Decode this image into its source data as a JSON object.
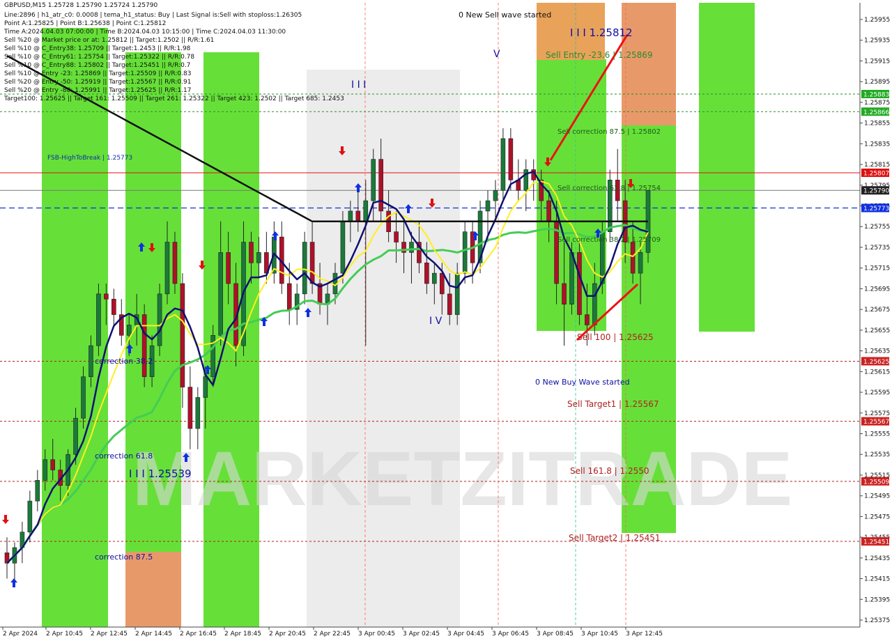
{
  "chart_data": {
    "type": "candlestick",
    "symbol_header": "GBPUSD,M15  1.25728 1.25790 1.25724 1.25790",
    "info_lines": [
      "Line:2896 | h1_atr_c0: 0.0008 | tema_h1_status: Buy | Last Signal is:Sell with stoploss:1.26305",
      "Point A:1.25825 | Point B:1.25638 | Point C:1.25812",
      "Time A:2024.04.03 07:00:00 | Time B:2024.04.03 10:15:00 | Time C:2024.04.03 11:30:00",
      "Sell %20 @ Market price or at: 1.25812 || Target:1.2502 || R/R:1.61",
      "Sell %10 @ C_Entry38: 1.25709 || Target:1.2453 || R/R:1.98",
      "Sell %10 @ C_Entry61: 1.25754 || Target:1.25322 || R/R:0.78",
      "Sell %10 @ C_Entry88: 1.25802 || Target:1.25451 || R/R:0.7",
      "Sell %10 @ Entry -23: 1.25869 || Target:1.25509 || R/R:0.83",
      "Sell %20 @ Entry -50: 1.25919 || Target:1.25567 || R/R:0.91",
      "Sell %20 @ Entry -88: 1.25991 || Target:1.25625 || R/R:1.17",
      "Target100: 1.25625 || Target 161: 1.25509 || Target 261: 1.25322 || Target 423: 1.2502 || Target 685: 1.2453"
    ],
    "y_axis": {
      "min": 1.25368,
      "max": 1.25912,
      "ticks": [
        "1.25955",
        "1.25935",
        "1.25915",
        "1.25895",
        "1.25875",
        "1.25855",
        "1.25835",
        "1.25815",
        "1.25795",
        "1.25775",
        "1.25755",
        "1.25735",
        "1.25715",
        "1.25695",
        "1.25675",
        "1.25655",
        "1.25635",
        "1.25615",
        "1.25595",
        "1.25575",
        "1.25555",
        "1.25535",
        "1.25515",
        "1.25495",
        "1.25475",
        "1.25455",
        "1.25435",
        "1.25415",
        "1.25395",
        "1.25375"
      ],
      "tick_values": [
        1.25955,
        1.25935,
        1.25915,
        1.25895,
        1.25875,
        1.25855,
        1.25835,
        1.25815,
        1.25795,
        1.25775,
        1.25755,
        1.25735,
        1.25715,
        1.25695,
        1.25675,
        1.25655,
        1.25635,
        1.25615,
        1.25595,
        1.25575,
        1.25555,
        1.25535,
        1.25515,
        1.25495,
        1.25475,
        1.25455,
        1.25435,
        1.25415,
        1.25395,
        1.25375
      ]
    },
    "x_labels": [
      "2 Apr 2024",
      "2 Apr 10:45",
      "2 Apr 12:45",
      "2 Apr 14:45",
      "2 Apr 16:45",
      "2 Apr 18:45",
      "2 Apr 20:45",
      "2 Apr 22:45",
      "3 Apr 00:45",
      "3 Apr 02:45",
      "3 Apr 04:45",
      "3 Apr 06:45",
      "3 Apr 08:45",
      "3 Apr 10:45",
      "3 Apr 12:45"
    ],
    "price_badges": [
      {
        "label": "1.25883",
        "value": 1.25883,
        "color": "#22aa22"
      },
      {
        "label": "1.25866",
        "value": 1.25866,
        "color": "#22aa22"
      },
      {
        "label": "1.25807",
        "value": 1.25807,
        "color": "#e01010"
      },
      {
        "label": "1.25790",
        "value": 1.2579,
        "color": "#222222"
      },
      {
        "label": "1.25773",
        "value": 1.25773,
        "color": "#1030e0"
      },
      {
        "label": "1.25625",
        "value": 1.25625,
        "color": "#cc2222"
      },
      {
        "label": "1.25567",
        "value": 1.25567,
        "color": "#cc2222"
      },
      {
        "label": "1.25509",
        "value": 1.25509,
        "color": "#cc2222"
      },
      {
        "label": "1.25451",
        "value": 1.25451,
        "color": "#cc2222"
      }
    ],
    "levels": [
      {
        "label": "Sell Entry -23.6 | 1.25869",
        "value": 1.25869,
        "color": "#2a8a2a"
      },
      {
        "label": "Sell correction 87.5 | 1.25802",
        "value": 1.25802,
        "color": "#2a8a2a"
      },
      {
        "label": "Sell correction 61.8 | 1.25754",
        "value": 1.25754,
        "color": "#2a8a2a"
      },
      {
        "label": "Sell correction 38.2 | 1.25709",
        "value": 1.25709,
        "color": "#2a8a2a"
      },
      {
        "label": "Sell 100 | 1.25625",
        "value": 1.25625,
        "color": "#b02020"
      },
      {
        "label": "Sell Target1 | 1.25567",
        "value": 1.25567,
        "color": "#b02020"
      },
      {
        "label": "Sell 161.8 | 1.2550",
        "value": 1.25509,
        "color": "#b02020"
      },
      {
        "label": "Sell Target2 | 1.25451",
        "value": 1.25451,
        "color": "#b02020"
      }
    ],
    "fsb_label": "FSB-HighToBreak | 1.25773",
    "annotations": [
      {
        "text": "0 New Sell wave started",
        "color": "#111111"
      },
      {
        "text": "0 New Buy Wave started",
        "color": "#1010a0"
      },
      {
        "text": "I I I 1.25812",
        "color": "#1010a0"
      },
      {
        "text": "I I I 1.25539",
        "color": "#1010a0"
      },
      {
        "text": "correction 38.2",
        "color": "#1010a0"
      },
      {
        "text": "correction 61.8",
        "color": "#1010a0"
      },
      {
        "text": "correction 87.5",
        "color": "#1010a0"
      },
      {
        "text": "I I I",
        "color": "#1010a0"
      },
      {
        "text": "I V",
        "color": "#1010a0"
      },
      {
        "text": "V",
        "color": "#1010a0"
      }
    ],
    "watermark": "MARKETZITRADE",
    "candles": [
      [
        1.2544,
        1.25455,
        1.25415,
        1.2543
      ],
      [
        1.2543,
        1.2545,
        1.2541,
        1.25445
      ],
      [
        1.25445,
        1.2547,
        1.2543,
        1.2546
      ],
      [
        1.2546,
        1.255,
        1.2545,
        1.2549
      ],
      [
        1.2549,
        1.2552,
        1.2548,
        1.2551
      ],
      [
        1.2551,
        1.2554,
        1.255,
        1.2553
      ],
      [
        1.2553,
        1.2555,
        1.2551,
        1.2552
      ],
      [
        1.2552,
        1.2553,
        1.2549,
        1.25505
      ],
      [
        1.25505,
        1.2554,
        1.25495,
        1.25535
      ],
      [
        1.25535,
        1.2558,
        1.25525,
        1.2557
      ],
      [
        1.2557,
        1.2562,
        1.2556,
        1.2561
      ],
      [
        1.2561,
        1.2565,
        1.256,
        1.2564
      ],
      [
        1.2564,
        1.257,
        1.2563,
        1.2569
      ],
      [
        1.2569,
        1.257,
        1.2566,
        1.25685
      ],
      [
        1.25685,
        1.25695,
        1.2566,
        1.2567
      ],
      [
        1.2567,
        1.25685,
        1.2564,
        1.2565
      ],
      [
        1.2565,
        1.2567,
        1.2563,
        1.2566
      ],
      [
        1.2566,
        1.2569,
        1.2564,
        1.2567
      ],
      [
        1.2567,
        1.2568,
        1.256,
        1.2561
      ],
      [
        1.2561,
        1.2565,
        1.256,
        1.2564
      ],
      [
        1.2564,
        1.257,
        1.2563,
        1.2569
      ],
      [
        1.2569,
        1.2576,
        1.2568,
        1.2574
      ],
      [
        1.2574,
        1.2575,
        1.2569,
        1.257
      ],
      [
        1.257,
        1.2571,
        1.2558,
        1.256
      ],
      [
        1.256,
        1.2562,
        1.2554,
        1.2556
      ],
      [
        1.2556,
        1.256,
        1.2554,
        1.2559
      ],
      [
        1.2559,
        1.2562,
        1.2556,
        1.2561
      ],
      [
        1.2561,
        1.2566,
        1.256,
        1.2565
      ],
      [
        1.2565,
        1.2576,
        1.2564,
        1.2573
      ],
      [
        1.2573,
        1.2575,
        1.2568,
        1.257
      ],
      [
        1.257,
        1.2572,
        1.2562,
        1.2564
      ],
      [
        1.2564,
        1.2576,
        1.2563,
        1.2574
      ],
      [
        1.2574,
        1.2575,
        1.257,
        1.2572
      ],
      [
        1.2572,
        1.25745,
        1.25705,
        1.2573
      ],
      [
        1.2573,
        1.2575,
        1.257,
        1.2571
      ],
      [
        1.2571,
        1.2576,
        1.257,
        1.25745
      ],
      [
        1.25745,
        1.2576,
        1.2569,
        1.257
      ],
      [
        1.257,
        1.2572,
        1.2566,
        1.25675
      ],
      [
        1.25675,
        1.257,
        1.2566,
        1.2569
      ],
      [
        1.2569,
        1.2575,
        1.2568,
        1.2574
      ],
      [
        1.2574,
        1.2576,
        1.2569,
        1.257
      ],
      [
        1.257,
        1.2572,
        1.2567,
        1.2568
      ],
      [
        1.2568,
        1.257,
        1.2566,
        1.2569
      ],
      [
        1.2569,
        1.2572,
        1.2568,
        1.2571
      ],
      [
        1.2571,
        1.2577,
        1.257,
        1.2576
      ],
      [
        1.2576,
        1.2578,
        1.2574,
        1.2577
      ],
      [
        1.2577,
        1.2579,
        1.2575,
        1.2576
      ],
      [
        1.2576,
        1.258,
        1.2564,
        1.2578
      ],
      [
        1.2578,
        1.2583,
        1.2576,
        1.2582
      ],
      [
        1.2582,
        1.2584,
        1.2576,
        1.2577
      ],
      [
        1.2577,
        1.2579,
        1.2574,
        1.2575
      ],
      [
        1.2575,
        1.2577,
        1.2572,
        1.2574
      ],
      [
        1.2574,
        1.2576,
        1.2571,
        1.2573
      ],
      [
        1.2573,
        1.2575,
        1.257,
        1.2574
      ],
      [
        1.2574,
        1.2576,
        1.2571,
        1.2572
      ],
      [
        1.2572,
        1.2574,
        1.2569,
        1.257
      ],
      [
        1.257,
        1.2572,
        1.2568,
        1.2571
      ],
      [
        1.2571,
        1.2572,
        1.2567,
        1.2569
      ],
      [
        1.2569,
        1.2571,
        1.2566,
        1.2567
      ],
      [
        1.2567,
        1.2572,
        1.2566,
        1.2571
      ],
      [
        1.2571,
        1.2576,
        1.257,
        1.2575
      ],
      [
        1.2575,
        1.2576,
        1.257,
        1.2572
      ],
      [
        1.2572,
        1.2578,
        1.2571,
        1.2577
      ],
      [
        1.2577,
        1.2579,
        1.2574,
        1.2578
      ],
      [
        1.2578,
        1.258,
        1.2576,
        1.2579
      ],
      [
        1.2579,
        1.2585,
        1.2578,
        1.2584
      ],
      [
        1.2584,
        1.2585,
        1.2579,
        1.258
      ],
      [
        1.258,
        1.2582,
        1.2578,
        1.2579
      ],
      [
        1.2579,
        1.2582,
        1.2577,
        1.2581
      ],
      [
        1.2581,
        1.2582,
        1.2578,
        1.258
      ],
      [
        1.258,
        1.2581,
        1.2576,
        1.2578
      ],
      [
        1.2578,
        1.2579,
        1.2574,
        1.2576
      ],
      [
        1.2576,
        1.2578,
        1.2568,
        1.257
      ],
      [
        1.257,
        1.2574,
        1.2564,
        1.2568
      ],
      [
        1.2568,
        1.2574,
        1.2567,
        1.2573
      ],
      [
        1.2573,
        1.2574,
        1.2566,
        1.2567
      ],
      [
        1.2567,
        1.257,
        1.2564,
        1.2566
      ],
      [
        1.2566,
        1.2572,
        1.2565,
        1.257
      ],
      [
        1.257,
        1.2576,
        1.2569,
        1.2575
      ],
      [
        1.2575,
        1.2581,
        1.2574,
        1.258
      ],
      [
        1.258,
        1.2583,
        1.2576,
        1.2578
      ],
      [
        1.2578,
        1.258,
        1.2572,
        1.2574
      ],
      [
        1.2574,
        1.2576,
        1.257,
        1.2571
      ],
      [
        1.2571,
        1.2574,
        1.2568,
        1.2573
      ],
      [
        1.2573,
        1.2579,
        1.2572,
        1.2579
      ]
    ]
  }
}
